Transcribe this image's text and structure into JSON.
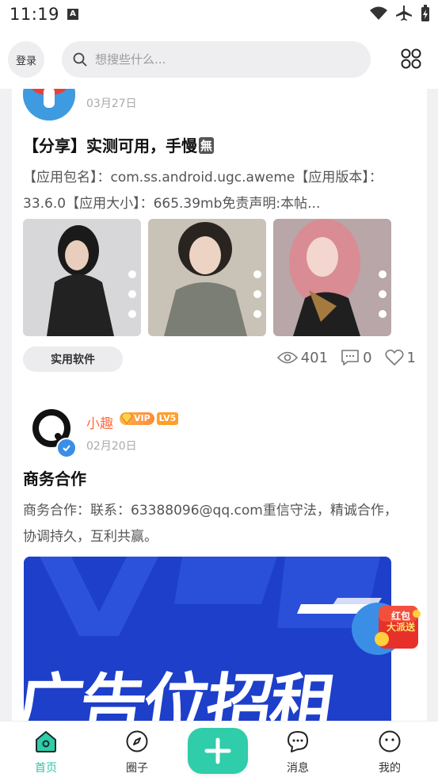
{
  "status_bar": {
    "time": "11:19",
    "notification_icon": "A"
  },
  "header": {
    "login_label": "登录",
    "search_placeholder": "想搜些什么..."
  },
  "posts": [
    {
      "date": "03月27日",
      "title": "【分享】实测可用，手慢",
      "title_emoji": "無",
      "body": "【应用包名】：com.ss.android.ugc.aweme【应用版本】：33.6.0【应用大小】：665.39mb免责声明:本帖...",
      "images": [
        "video-thumb-1",
        "video-thumb-2",
        "video-thumb-3"
      ],
      "tag": "实用软件",
      "views": "401",
      "comments": "0",
      "likes": "1"
    },
    {
      "author": "小趣",
      "vip_label": "VIP",
      "level_label": "LV5",
      "date": "02月20日",
      "title": "商务合作",
      "body": "商务合作：联系：63388096@qq.com重信守法，精诚合作，协调持久，互利共赢。",
      "banner_text": "广告位招租"
    }
  ],
  "float": {
    "redpack_line1": "红包",
    "redpack_line2": "大派送"
  },
  "tabs": [
    {
      "label": "首页",
      "icon": "home-icon",
      "active": true
    },
    {
      "label": "圈子",
      "icon": "compass-icon",
      "active": false
    },
    {
      "label": "消息",
      "icon": "chat-icon",
      "active": false
    },
    {
      "label": "我的",
      "icon": "profile-icon",
      "active": false
    }
  ],
  "colors": {
    "accent": "#2fcda9",
    "username": "#ff6a3d",
    "banner": "#1b3fc8"
  }
}
